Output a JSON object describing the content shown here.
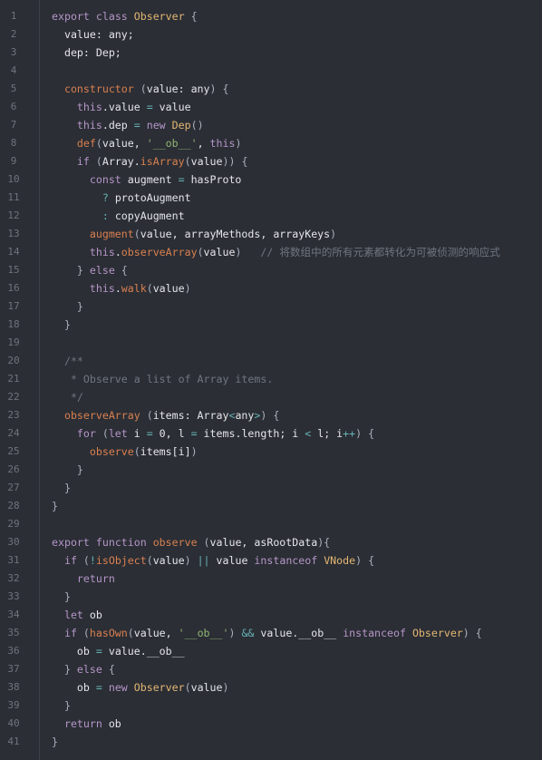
{
  "colors": {
    "background": "#2b2e35",
    "keyword": "#b596c8",
    "class": "#e3b773",
    "function": "#d9804f",
    "string": "#8fb573",
    "operator": "#66b2b4",
    "comment": "#6f7680",
    "text": "#e4e6ea"
  },
  "lines": [
    [
      [
        "k",
        "export "
      ],
      [
        "k",
        "class "
      ],
      [
        "c",
        "Observer "
      ],
      [
        "p",
        "{"
      ]
    ],
    [
      [
        "i",
        "  value: any;"
      ]
    ],
    [
      [
        "i",
        "  dep: Dep;"
      ]
    ],
    [],
    [
      [
        "f",
        "  constructor "
      ],
      [
        "p",
        "("
      ],
      [
        "i",
        "value: any"
      ],
      [
        "p",
        ") {"
      ]
    ],
    [
      [
        "k",
        "    this"
      ],
      [
        "i",
        ".value "
      ],
      [
        "o",
        "="
      ],
      [
        "i",
        " value"
      ]
    ],
    [
      [
        "k",
        "    this"
      ],
      [
        "i",
        ".dep "
      ],
      [
        "o",
        "="
      ],
      [
        "k",
        " new "
      ],
      [
        "c",
        "Dep"
      ],
      [
        "p",
        "()"
      ]
    ],
    [
      [
        "f",
        "    def"
      ],
      [
        "p",
        "("
      ],
      [
        "i",
        "value, "
      ],
      [
        "s",
        "'__ob__'"
      ],
      [
        "i",
        ", "
      ],
      [
        "k",
        "this"
      ],
      [
        "p",
        ")"
      ]
    ],
    [
      [
        "k",
        "    if "
      ],
      [
        "p",
        "("
      ],
      [
        "i",
        "Array."
      ],
      [
        "f",
        "isArray"
      ],
      [
        "p",
        "("
      ],
      [
        "i",
        "value"
      ],
      [
        "p",
        ")) {"
      ]
    ],
    [
      [
        "k",
        "      const "
      ],
      [
        "i",
        "augment "
      ],
      [
        "o",
        "="
      ],
      [
        "i",
        " hasProto"
      ]
    ],
    [
      [
        "o",
        "        ? "
      ],
      [
        "i",
        "protoAugment"
      ]
    ],
    [
      [
        "o",
        "        : "
      ],
      [
        "i",
        "copyAugment"
      ]
    ],
    [
      [
        "f",
        "      augment"
      ],
      [
        "p",
        "("
      ],
      [
        "i",
        "value, arrayMethods, arrayKeys"
      ],
      [
        "p",
        ")"
      ]
    ],
    [
      [
        "k",
        "      this"
      ],
      [
        "i",
        "."
      ],
      [
        "f",
        "observeArray"
      ],
      [
        "p",
        "("
      ],
      [
        "i",
        "value"
      ],
      [
        "p",
        ")"
      ],
      [
        "m",
        "   // 将数组中的所有元素都转化为可被侦测的响应式"
      ]
    ],
    [
      [
        "p",
        "    } "
      ],
      [
        "k",
        "else "
      ],
      [
        "p",
        "{"
      ]
    ],
    [
      [
        "k",
        "      this"
      ],
      [
        "i",
        "."
      ],
      [
        "f",
        "walk"
      ],
      [
        "p",
        "("
      ],
      [
        "i",
        "value"
      ],
      [
        "p",
        ")"
      ]
    ],
    [
      [
        "p",
        "    }"
      ]
    ],
    [
      [
        "p",
        "  }"
      ]
    ],
    [],
    [
      [
        "m",
        "  /**"
      ]
    ],
    [
      [
        "m",
        "   * Observe a list of Array items."
      ]
    ],
    [
      [
        "m",
        "   */"
      ]
    ],
    [
      [
        "f",
        "  observeArray "
      ],
      [
        "p",
        "("
      ],
      [
        "i",
        "items: Array"
      ],
      [
        "o",
        "<"
      ],
      [
        "i",
        "any"
      ],
      [
        "o",
        ">"
      ],
      [
        "p",
        ") {"
      ]
    ],
    [
      [
        "k",
        "    for "
      ],
      [
        "p",
        "("
      ],
      [
        "k",
        "let "
      ],
      [
        "i",
        "i "
      ],
      [
        "o",
        "="
      ],
      [
        "i",
        " 0, l "
      ],
      [
        "o",
        "="
      ],
      [
        "i",
        " items.length; i "
      ],
      [
        "o",
        "<"
      ],
      [
        "i",
        " l; i"
      ],
      [
        "o",
        "++"
      ],
      [
        "p",
        ") {"
      ]
    ],
    [
      [
        "f",
        "      observe"
      ],
      [
        "p",
        "("
      ],
      [
        "i",
        "items[i]"
      ],
      [
        "p",
        ")"
      ]
    ],
    [
      [
        "p",
        "    }"
      ]
    ],
    [
      [
        "p",
        "  }"
      ]
    ],
    [
      [
        "p",
        "}"
      ]
    ],
    [],
    [
      [
        "k",
        "export "
      ],
      [
        "k",
        "function "
      ],
      [
        "f",
        "observe "
      ],
      [
        "p",
        "("
      ],
      [
        "i",
        "value, asRootData"
      ],
      [
        "p",
        "){"
      ]
    ],
    [
      [
        "k",
        "  if "
      ],
      [
        "p",
        "("
      ],
      [
        "o",
        "!"
      ],
      [
        "f",
        "isObject"
      ],
      [
        "p",
        "("
      ],
      [
        "i",
        "value"
      ],
      [
        "p",
        ") "
      ],
      [
        "o",
        "||"
      ],
      [
        "i",
        " value "
      ],
      [
        "k",
        "instanceof "
      ],
      [
        "c",
        "VNode"
      ],
      [
        "p",
        ") {"
      ]
    ],
    [
      [
        "k",
        "    return"
      ]
    ],
    [
      [
        "p",
        "  }"
      ]
    ],
    [
      [
        "k",
        "  let "
      ],
      [
        "i",
        "ob"
      ]
    ],
    [
      [
        "k",
        "  if "
      ],
      [
        "p",
        "("
      ],
      [
        "f",
        "hasOwn"
      ],
      [
        "p",
        "("
      ],
      [
        "i",
        "value, "
      ],
      [
        "s",
        "'__ob__'"
      ],
      [
        "p",
        ") "
      ],
      [
        "o",
        "&&"
      ],
      [
        "i",
        " value.__ob__ "
      ],
      [
        "k",
        "instanceof "
      ],
      [
        "c",
        "Observer"
      ],
      [
        "p",
        ") {"
      ]
    ],
    [
      [
        "i",
        "    ob "
      ],
      [
        "o",
        "="
      ],
      [
        "i",
        " value.__ob__"
      ]
    ],
    [
      [
        "p",
        "  } "
      ],
      [
        "k",
        "else "
      ],
      [
        "p",
        "{"
      ]
    ],
    [
      [
        "i",
        "    ob "
      ],
      [
        "o",
        "="
      ],
      [
        "k",
        " new "
      ],
      [
        "c",
        "Observer"
      ],
      [
        "p",
        "("
      ],
      [
        "i",
        "value"
      ],
      [
        "p",
        ")"
      ]
    ],
    [
      [
        "p",
        "  }"
      ]
    ],
    [
      [
        "k",
        "  return "
      ],
      [
        "i",
        "ob"
      ]
    ],
    [
      [
        "p",
        "}"
      ]
    ]
  ]
}
